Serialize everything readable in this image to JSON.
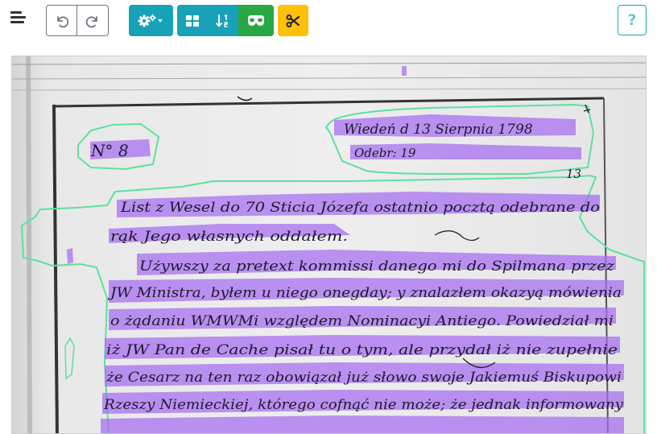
{
  "toolbar": {
    "menu_icon": "hamburger-menu-icon",
    "undo_icon": "undo-icon",
    "redo_icon": "redo-icon",
    "settings_icon": "settings-cogs-dropdown-icon",
    "grid_icon": "grid-view-icon",
    "sort_icon": "sort-order-icon",
    "view_icon": "mask-view-icon",
    "cut_icon": "scissors-icon",
    "help_label": "?"
  },
  "colors": {
    "info": "#17a2b8",
    "success": "#28a745",
    "warning": "#ffc107",
    "region_outline": "#5de0a0",
    "line_highlight": "#a66cf2"
  },
  "document": {
    "header_lines": [
      "Wiedeń d 13 Sierpnia 1798",
      "Odebr: 19"
    ],
    "margin_label": "N° 8",
    "page_number": "13",
    "lines": [
      "List z Wesel do 70 Sticia Józefa ostatnio pocztą odebrane do",
      "rąk Jego własnych oddałem.",
      "Używszy za pretext kommissi danego mi do Spilmana przez",
      "JW Ministra, byłem u niego onegday; y znalazłem okazyą mówienia",
      "o żądaniu WMWMi względem Nominacyi Antiego. Powiedział mi",
      "iż JW Pan de Cache pisał tu o tym, ale przydał iż nie zupełnie",
      "że Cesarz na ten raz obowiązał już słowo swoje Jakiemuś Biskupowi",
      "Rzeszy Niemieckiej, którego cofnąć nie może; że jednak informowany"
    ]
  }
}
